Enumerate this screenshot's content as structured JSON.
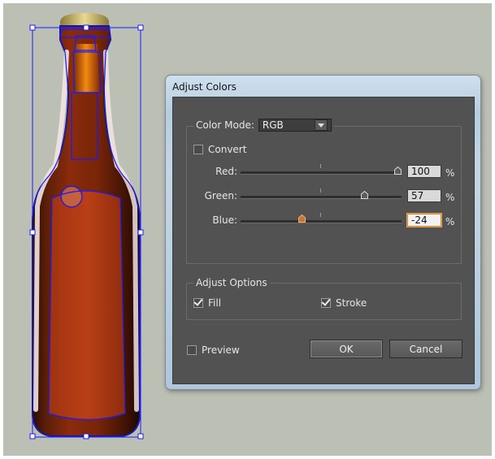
{
  "dialog": {
    "title": "Adjust Colors",
    "color_mode_label": "Color Mode:",
    "color_mode_value": "RGB",
    "convert_label": "Convert",
    "convert_checked": false,
    "sliders": [
      {
        "label": "Red:",
        "value": "100",
        "unit": "%",
        "position": 1.0
      },
      {
        "label": "Green:",
        "value": "57",
        "unit": "%",
        "position": 0.785
      },
      {
        "label": "Blue:",
        "value": "-24",
        "unit": "%",
        "position": 0.38
      }
    ],
    "adjust_options_label": "Adjust Options",
    "fill_label": "Fill",
    "fill_checked": true,
    "stroke_label": "Stroke",
    "stroke_checked": true,
    "preview_label": "Preview",
    "preview_checked": false,
    "ok_label": "OK",
    "cancel_label": "Cancel"
  },
  "colors": {
    "canvas_bg": "#bcc0b4",
    "selection": "#1a1aff",
    "dialog_body": "#525252",
    "focus_accent": "#e8a050",
    "bottle_brown": "#5a1e08",
    "bottle_amber": "#b0350e"
  },
  "icons": {
    "dropdown": "chevron-down-icon",
    "slider_thumb": "slider-thumb-icon"
  }
}
